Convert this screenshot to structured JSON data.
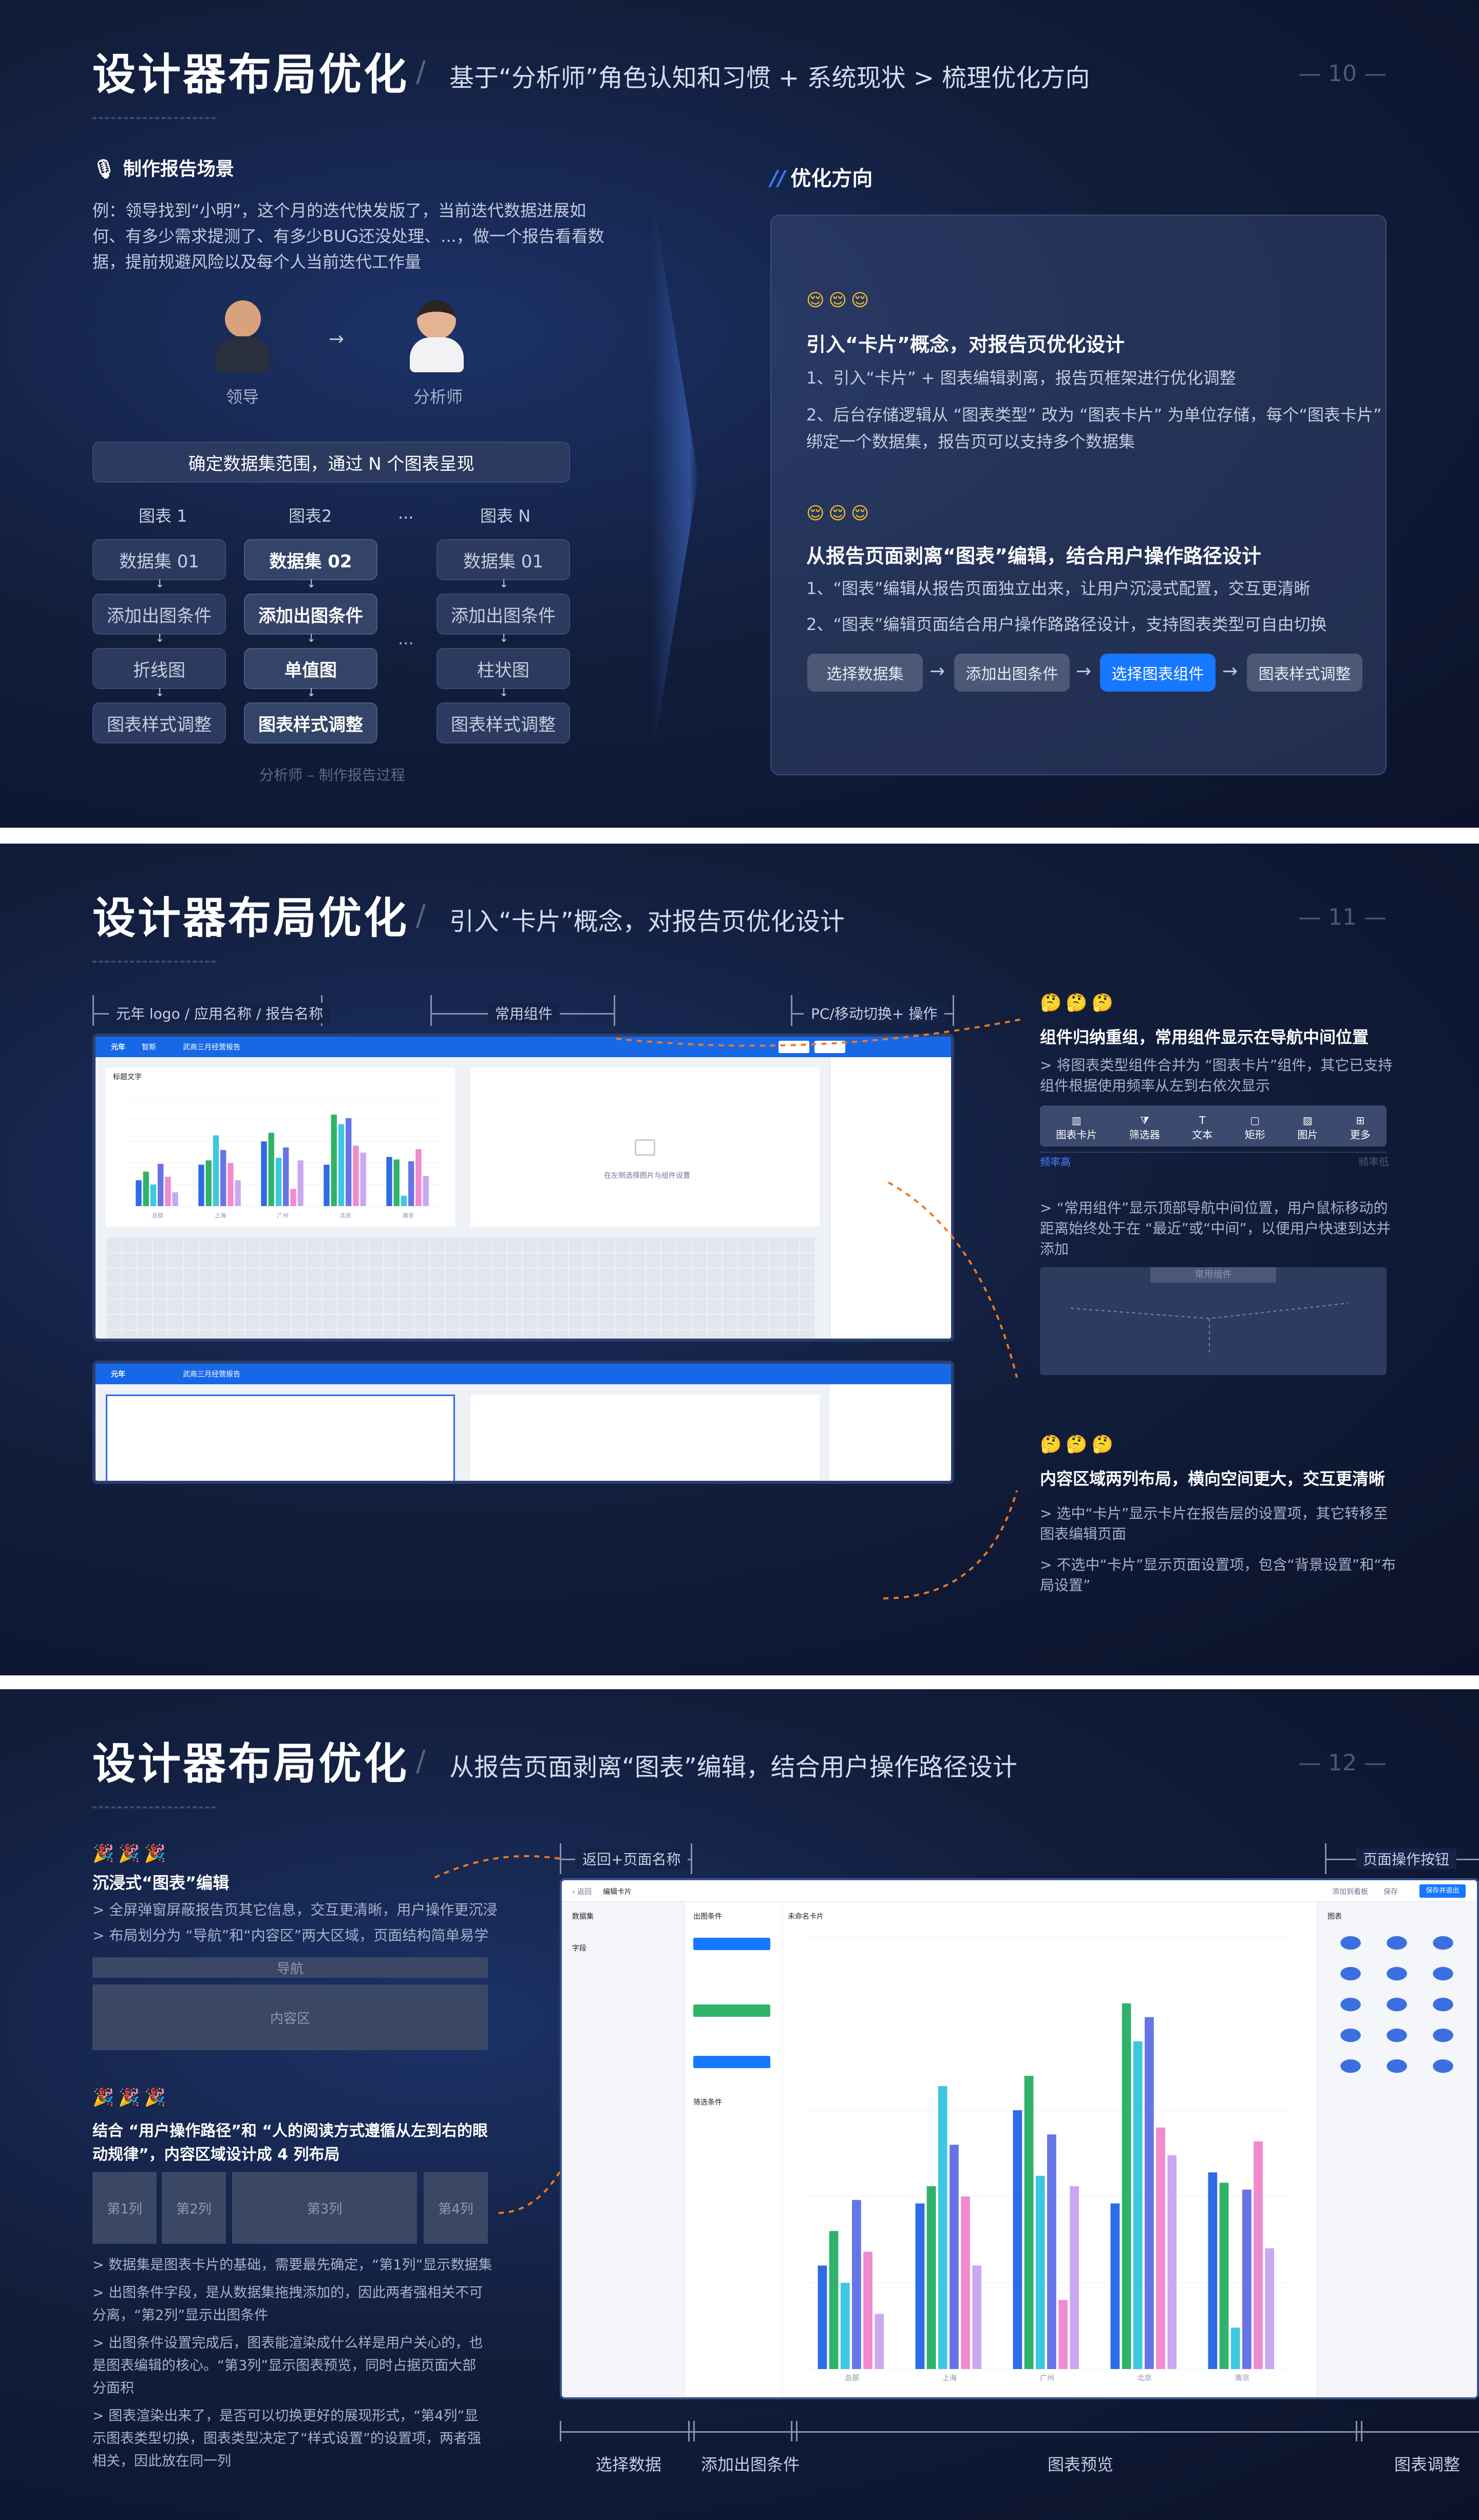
{
  "s1": {
    "title": "设计器布局优化",
    "subtitle": "基于“分析师”角色认知和习惯 + 系统现状 > 梳理优化方向",
    "page": "— 10 —",
    "scene_title": "制作报告场景",
    "scene_text": [
      "例：领导找到“小明”，这个月的迭代快发版了，当前迭代数据进展如",
      "何、有多少需求提测了、有多少BUG还没处理、...，做一个报告看看数",
      "据，提前规避风险以及每个人当前迭代工作量"
    ],
    "role_leader": "领导",
    "role_analyst": "分析师",
    "scope": "确定数据集范围，通过 N 个图表呈现",
    "col_heads": [
      "图表 1",
      "图表2",
      "...",
      "图表 N"
    ],
    "col1": [
      "数据集 01",
      "添加出图条件",
      "折线图",
      "图表样式调整"
    ],
    "col2": [
      "数据集 02",
      "添加出图条件",
      "单值图",
      "图表样式调整"
    ],
    "col3": [
      "数据集 01",
      "添加出图条件",
      "柱状图",
      "图表样式调整"
    ],
    "flow_dots": "...",
    "caption": "分析师 – 制作报告过程",
    "opt_title": "优化方向",
    "p1_title": "引入“卡片”概念，对报告页优化设计",
    "p1_lines": [
      "1、引入“卡片” + 图表编辑剥离，报告页框架进行优化调整",
      "2、后台存储逻辑从 “图表类型” 改为 “图表卡片” 为单位存储，每个“图表卡片”",
      "绑定一个数据集，报告页可以支持多个数据集"
    ],
    "p2_title": "从报告页面剥离“图表”编辑，结合用户操作路径设计",
    "p2_lines": [
      "1、“图表”编辑从报告页面独立出来，让用户沉浸式配置，交互更清晰",
      "2、“图表”编辑页面结合用户操作路路径设计，支持图表类型可自由切换"
    ],
    "steps": [
      "选择数据集",
      "添加出图条件",
      "选择图表组件",
      "图表样式调整"
    ]
  },
  "s2": {
    "title": "设计器布局优化",
    "subtitle": "引入“卡片”概念，对报告页优化设计",
    "page": "— 11 —",
    "brackets": [
      "元年 logo / 应用名称 / 报告名称",
      "常用组件",
      "PC/移动切换+ 操作"
    ],
    "mock_bar": [
      "智斯",
      "武商三月经营报告"
    ],
    "chart_title": "标题文字",
    "placeholder": "在左侧选择图片与组件设置",
    "t1": "组件归纳重组，常用组件显示在导航中间位置",
    "t1_desc": [
      "> 将图表类型组件合并为 “图表卡片”组件，其它已支持",
      "组件根据使用频率从左到右依次显示"
    ],
    "toolbar": [
      "图表卡片",
      "筛选器",
      "文本",
      "矩形",
      "图片",
      "更多"
    ],
    "freq": [
      "频率高",
      "频率低"
    ],
    "t1_desc2": [
      "> “常用组件”显示顶部导航中间位置，用户鼠标移动的",
      "距离始终处于在 “最近”或“中间”，以便用户快速到达并",
      "添加"
    ],
    "common": "常用组件",
    "t2": "内容区域两列布局，横向空间更大，交互更清晰",
    "t2_desc": [
      "> 选中“卡片”显示卡片在报告层的设置项，其它转移至",
      "图表编辑页面",
      "> 不选中“卡片”显示页面设置项，包含“背景设置”和“布",
      "局设置”"
    ]
  },
  "s3": {
    "title": "设计器布局优化",
    "subtitle": "从报告页面剥离“图表”编辑，结合用户操作路径设计",
    "page": "— 12 —",
    "a_title": "沉浸式“图表”编辑",
    "a_lines": [
      "> 全屏弹窗屏蔽报告页其它信息，交互更清晰，用户操作更沉浸",
      "> 布局划分为 “导航”和“内容区”两大区域，页面结构简单易学"
    ],
    "nav": "导航",
    "content": "内容区",
    "b_title": [
      "结合 “用户操作路径”和 “人的阅读方式遵循从左到右的眼",
      "动规律”，内容区域设计成 4 列布局"
    ],
    "cols": [
      "第1列",
      "第2列",
      "第3列",
      "第4列"
    ],
    "b_lines": [
      "> 数据集是图表卡片的基础，需要最先确定，“第1列”显示数据集",
      "> 出图条件字段，是从数据集拖拽添加的，因此两者强相关不可",
      "分离，“第2列”显示出图条件",
      "> 出图条件设置完成后，图表能渲染成什么样是用户关心的，也",
      "是图表编辑的核心。“第3列”显示图表预览，同时占据页面大部",
      "分面积",
      "> 图表渲染出来了，是否可以切换更好的展现形式，“第4列”显",
      "示图表类型切换，图表类型决定了“样式设置”的设置项，两者强",
      "相关，因此放在同一列"
    ],
    "top_labels": [
      "返回+页面名称",
      "页面操作按钮"
    ],
    "bottom_labels": [
      "选择数据",
      "添加出图条件",
      "图表预览",
      "图表调整"
    ],
    "mock_title": "编辑卡片",
    "ui": {
      "dataset": "数据集",
      "fields": "字段",
      "cond": "出图条件",
      "filter": "筛选条件",
      "card": "未命名卡片",
      "chart": "图表",
      "save": "保存",
      "done": "保存并退出",
      "add": "添加到看板"
    }
  },
  "chart_data": {
    "type": "bar",
    "categories": [
      "总部",
      "上海",
      "广州",
      "北京",
      "南京"
    ],
    "series": [
      {
        "name": "",
        "color": "#2e6be6",
        "values": [
          30,
          48,
          75,
          48,
          57
        ]
      },
      {
        "name": "",
        "color": "#2fb36a",
        "values": [
          40,
          53,
          85,
          106,
          54
        ]
      },
      {
        "name": "",
        "color": "#3cc8e0",
        "values": [
          25,
          82,
          56,
          95,
          12
        ]
      },
      {
        "name": "",
        "color": "#6675e6",
        "values": [
          49,
          65,
          68,
          102,
          52
        ]
      },
      {
        "name": "",
        "color": "#f08bd0",
        "values": [
          34,
          50,
          20,
          70,
          66
        ]
      },
      {
        "name": "",
        "color": "#c9a8f0",
        "values": [
          16,
          30,
          53,
          62,
          35
        ]
      }
    ],
    "ylim": [
      0,
      125
    ]
  }
}
